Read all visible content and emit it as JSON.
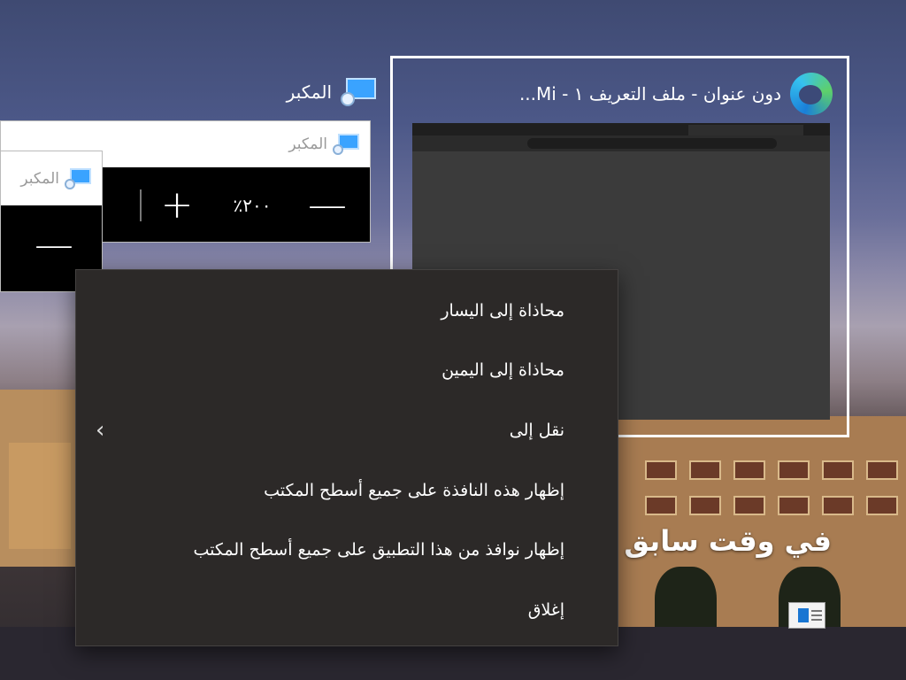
{
  "task_view_window": {
    "title": "دون عنوان - ملف التعريف ١ - Mi...",
    "app_icon": "edge-icon"
  },
  "magnifier": {
    "label": "المكبر",
    "header_title": "المكبر",
    "zoom_level": "٢٠٠٪",
    "zoom_in_symbol": "+",
    "zoom_out_symbol": "—",
    "icon": "magnifier-icon"
  },
  "wallpaper": {
    "previously_heading": "في وقت سابق"
  },
  "context_menu": {
    "items": [
      {
        "label": "محاذاة إلى اليسار",
        "has_submenu": false
      },
      {
        "label": "محاذاة إلى اليمين",
        "has_submenu": false
      },
      {
        "label": "نقل إلى",
        "has_submenu": true,
        "chevron": "‹"
      },
      {
        "label": "إظهار هذه النافذة على جميع أسطح المكتب",
        "has_submenu": false
      },
      {
        "label": "إظهار نوافذ من هذا التطبيق على جميع أسطح المكتب",
        "has_submenu": false
      },
      {
        "label": "إغلاق",
        "has_submenu": false
      }
    ]
  }
}
